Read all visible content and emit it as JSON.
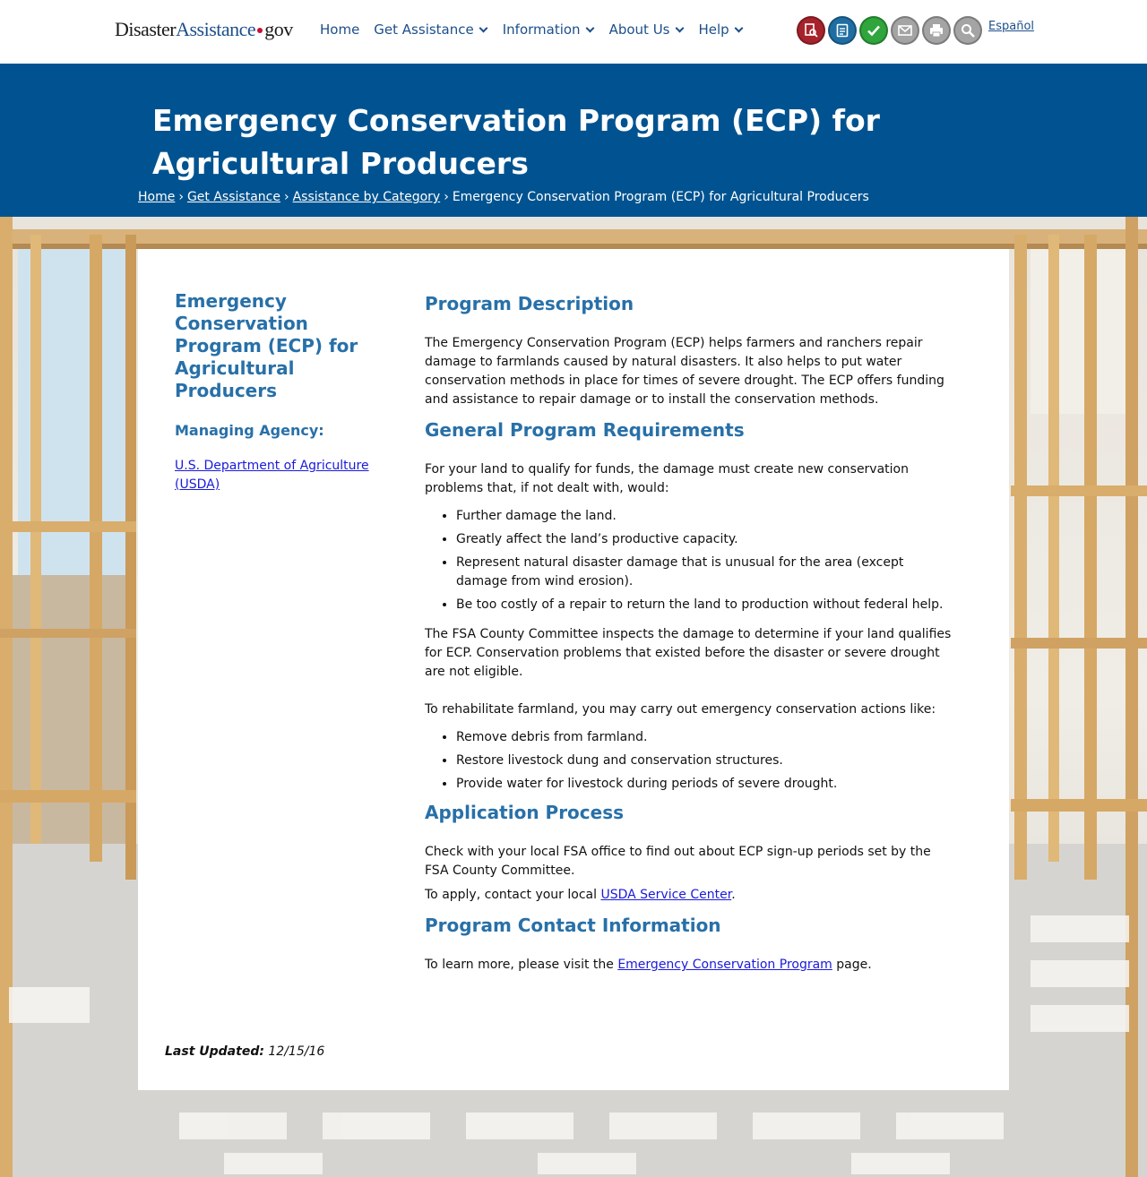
{
  "header": {
    "logo": {
      "part1": "Disaster",
      "part2": "Assistance",
      "part3": "gov"
    },
    "nav": [
      {
        "label": "Home",
        "dropdown": false
      },
      {
        "label": "Get Assistance",
        "dropdown": true
      },
      {
        "label": "Information",
        "dropdown": true
      },
      {
        "label": "About Us",
        "dropdown": true
      },
      {
        "label": "Help",
        "dropdown": true
      }
    ],
    "tools": [
      {
        "icon": "find-assistance-icon",
        "color": "#a7232c"
      },
      {
        "icon": "apply-online-icon",
        "color": "#1f6ea3"
      },
      {
        "icon": "check-status-icon",
        "color": "#2fa53c"
      },
      {
        "icon": "email-icon",
        "color": "#a4a4a4"
      },
      {
        "icon": "print-icon",
        "color": "#a4a4a4"
      },
      {
        "icon": "search-icon",
        "color": "#a4a4a4"
      }
    ],
    "language_link": "Español"
  },
  "banner": {
    "title": "Emergency Conservation Program (ECP) for Agricultural Producers",
    "breadcrumb": [
      "Home",
      "Get Assistance",
      "Assistance by Category",
      "Emergency Conservation Program (ECP) for Agricultural Producers"
    ]
  },
  "sidebar": {
    "title": "Emergency Conservation Program (ECP) for Agricultural Producers",
    "agency_heading": "Managing Agency:",
    "agency_link": "U.S. Department of Agriculture (USDA)"
  },
  "main": {
    "desc_heading": "Program Description",
    "desc_text": "The Emergency Conservation Program (ECP) helps farmers and ranchers repair damage to farmlands caused by natural disasters. It also helps to put water conservation methods in place for times of severe drought. The ECP offers funding and assistance to repair damage or to install the conservation methods.",
    "req_heading": "General Program Requirements",
    "req_intro": "For your land to qualify for funds, the damage must create new conservation problems that, if not dealt with, would:",
    "req_list": [
      "Further damage the land.",
      "Greatly affect the land’s productive capacity.",
      "Represent natural disaster damage that is unusual for the area (except damage from wind erosion).",
      "Be too costly of a repair to return the land to production without federal help."
    ],
    "req_para": "The FSA County Committee inspects the damage to determine if your land qualifies for ECP. Conservation problems that existed before the disaster or severe drought are not eligible.",
    "actions_intro": "To rehabilitate farmland, you may carry out emergency conservation actions like:",
    "actions_list": [
      "Remove debris from farmland.",
      "Restore livestock dung and conservation structures.",
      "Provide water for livestock during periods of severe drought."
    ],
    "app_heading": "Application Process",
    "app_text": "Check with your local FSA office to find out about ECP sign-up periods set by the FSA County Committee.",
    "apply_prefix": "To apply, contact your local ",
    "apply_link": "USDA Service Center",
    "apply_suffix": ".",
    "contact_heading": "Program Contact Information",
    "contact_prefix": "To learn more, please visit the ",
    "contact_link": "Emergency Conservation Program",
    "contact_suffix": " page."
  },
  "footer": {
    "updated_label": "Last Updated:",
    "updated_date": "12/15/16"
  }
}
